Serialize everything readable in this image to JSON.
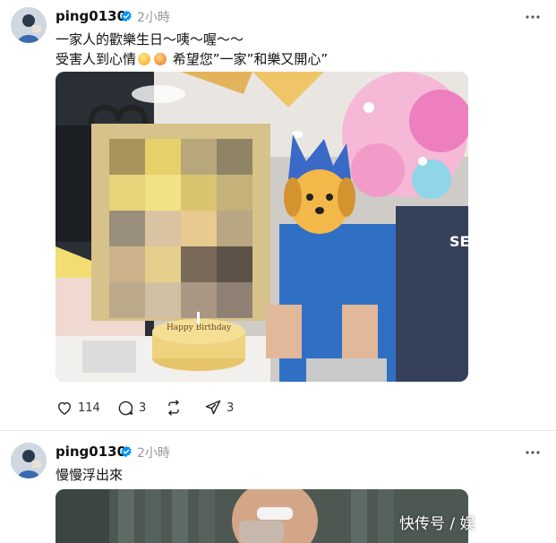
{
  "posts": [
    {
      "username": "ping0130",
      "timestamp": "2小時",
      "text_line_1": "一家人的歡樂生日～咦～喔～～",
      "text_line_2_before": "受害人到心情",
      "text_line_2_after": "希望您”一家”和樂又開心”",
      "photo": {
        "cake_text": "Happy Birthday",
        "shirt_logo": "SET"
      },
      "actions": {
        "likes": "114",
        "comments": "3",
        "shares": "3"
      }
    },
    {
      "username": "ping0130",
      "timestamp": "2小時",
      "text_line_1": "慢慢浮出來",
      "watermark": "快传号 / 娱"
    }
  ],
  "icons": {
    "verified": "verified-badge-icon",
    "more": "more-options-icon",
    "like": "heart-icon",
    "comment": "comment-icon",
    "repost": "repost-icon",
    "share": "share-icon"
  },
  "colors": {
    "verified_blue": "#0095f6",
    "text": "#111111",
    "muted": "#999999"
  }
}
